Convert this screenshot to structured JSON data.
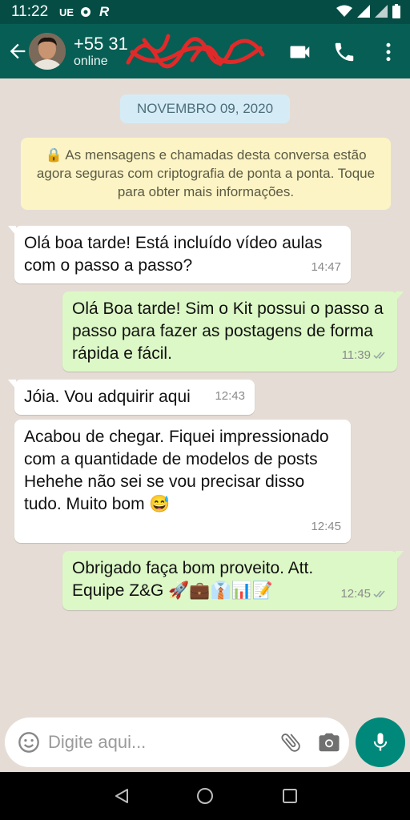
{
  "status_bar": {
    "time": "11:22",
    "indicator_ue": "UE",
    "indicator_r": "R"
  },
  "header": {
    "contact_name": "+55 31",
    "contact_status": "online"
  },
  "chat": {
    "date_chip": "NOVEMBRO 09, 2020",
    "encryption_notice": "🔒 As mensagens e chamadas desta conversa estão agora seguras com criptografia de ponta a ponta. Toque para obter mais informações.",
    "messages": [
      {
        "direction": "incoming",
        "text": "Olá boa tarde! Está incluído vídeo aulas com o passo a passo?",
        "time": "14:47"
      },
      {
        "direction": "outgoing",
        "text": "Olá Boa tarde! Sim o Kit possui o passo a passo para fazer as postagens de forma rápida e fácil.",
        "time": "11:39",
        "status": "read"
      },
      {
        "direction": "incoming",
        "text": "Jóia. Vou adquirir aqui",
        "time": "12:43"
      },
      {
        "direction": "incoming",
        "text": "Acabou de chegar. Fiquei impressionado com a quantidade de modelos de posts Hehehe não sei se vou precisar disso tudo. Muito bom 😅",
        "time": "12:45"
      },
      {
        "direction": "outgoing",
        "text": "Obrigado faça bom proveito. Att. Equipe Z&G 🚀💼👔📊📝",
        "time": "12:45",
        "status": "read"
      }
    ]
  },
  "input": {
    "placeholder": "Digite aqui..."
  },
  "colors": {
    "header": "#075e54",
    "status_bar": "#054d44",
    "chat_bg": "#e5ddd5",
    "outgoing_bubble": "#dcf8c6",
    "incoming_bubble": "#ffffff",
    "fab": "#00897b"
  },
  "icons": [
    "back-arrow-icon",
    "video-call-icon",
    "phone-icon",
    "more-vert-icon",
    "emoji-icon",
    "attach-icon",
    "camera-icon",
    "mic-icon",
    "read-ticks-icon",
    "nav-back-icon",
    "nav-home-icon",
    "nav-recents-icon"
  ]
}
